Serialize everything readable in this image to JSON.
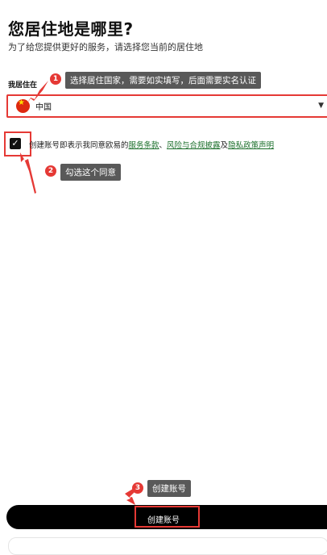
{
  "page": {
    "title": "您居住地是哪里?",
    "subtitle": "为了给您提供更好的服务，请选择您当前的居住地"
  },
  "residence": {
    "label": "我居住在",
    "selected": "中国",
    "flag_icon": "china-flag-icon"
  },
  "agreement": {
    "checked": true,
    "prefix": "创建账号即表示我同意欧易的",
    "link1": "服务条款",
    "sep1": "、",
    "link2": "风险与合规披露",
    "sep2": "及",
    "link3": "隐私政策声明"
  },
  "annotations": [
    {
      "number": "1",
      "text": "选择居住国家，需要如实填写，后面需要实名认证"
    },
    {
      "number": "2",
      "text": "勾选这个同意"
    },
    {
      "number": "3",
      "text": "创建账号"
    }
  ],
  "actions": {
    "create_account": "创建账号"
  },
  "colors": {
    "accent_red": "#e53935",
    "link_green": "#1a6e2a",
    "button_black": "#000000"
  }
}
